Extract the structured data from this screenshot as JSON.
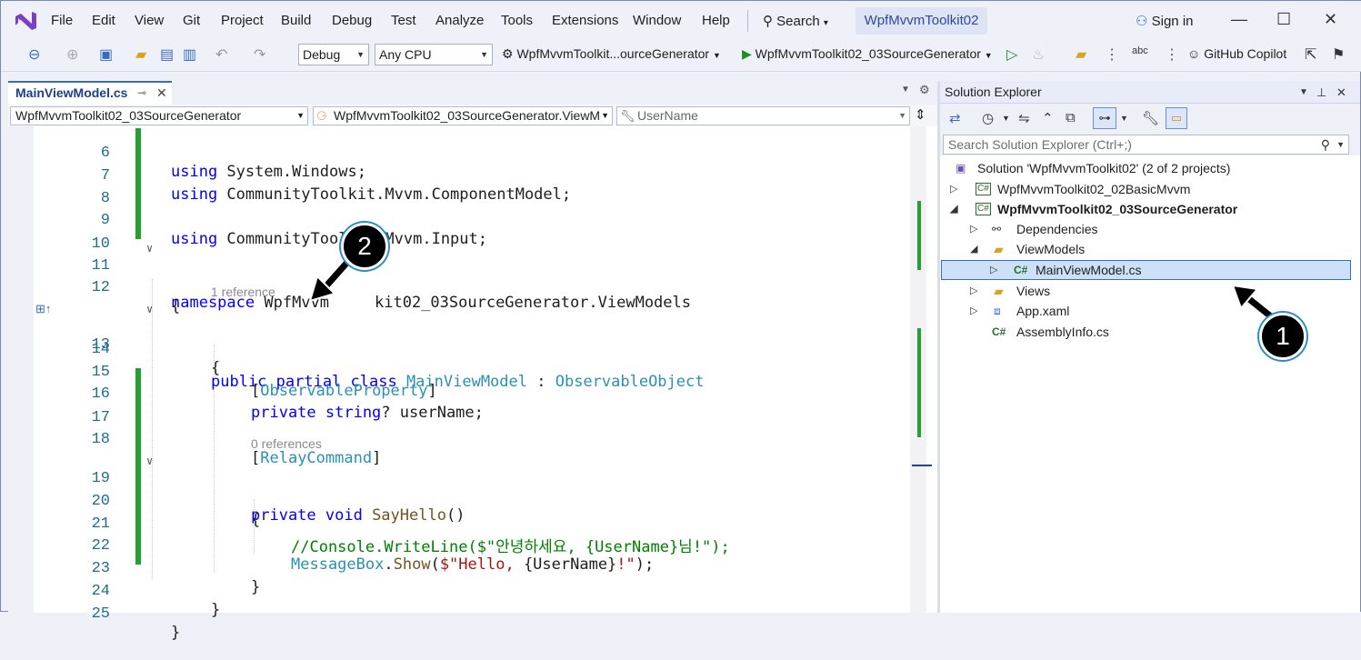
{
  "menu": [
    "File",
    "Edit",
    "View",
    "Git",
    "Project",
    "Build",
    "Debug",
    "Test",
    "Analyze",
    "Tools",
    "Extensions",
    "Window",
    "Help"
  ],
  "search_label": "Search",
  "solution_title": "WpfMvvmToolkit02",
  "sign_in": "Sign in",
  "toolbar": {
    "config": "Debug",
    "platform": "Any CPU",
    "startup_combo": "WpfMvvmToolkit...ourceGenerator",
    "run_target": "WpfMvvmToolkit02_03SourceGenerator",
    "copilot": "GitHub Copilot"
  },
  "editor": {
    "tab": "MainViewModel.cs",
    "nav_project": "WpfMvvmToolkit02_03SourceGenerator",
    "nav_type": "WpfMvvmToolkit02_03SourceGenerator.ViewM",
    "nav_member": "UserName",
    "ref_hint_1": "1 reference",
    "ref_hint_2": "0 references",
    "line_numbers": [
      "6",
      "7",
      "8",
      "9",
      "10",
      "11",
      "12",
      "13",
      "14",
      "15",
      "16",
      "17",
      "18",
      "19",
      "20",
      "21",
      "22",
      "23",
      "24",
      "25"
    ],
    "code": {
      "l6_kw": "using",
      "l6_rest": " System.Windows;",
      "l7_kw": "using",
      "l7_rest": " CommunityToolkit.Mvvm.ComponentModel;",
      "l9_kw": "using",
      "l9_rest": " CommunityToolkit.Mvvm.Input;",
      "l11_kw": "namespace",
      "l11_a": " WpfMvvm",
      "l11_b": "kit02_03SourceGenerator.ViewModels",
      "l12": "{",
      "l13_kw": "public partial class",
      "l13_type": " MainViewModel",
      "l13_colon": " : ",
      "l13_base": "ObservableObject",
      "l14": "{",
      "l15_open": "[",
      "l15_attr": "ObservableProperty",
      "l15_close": "]",
      "l16_kw": "private string",
      "l16_rest": "? userName;",
      "l18_open": "[",
      "l18_attr": "RelayCommand",
      "l18_close": "]",
      "l19_kw": "private void",
      "l19_method": " SayHello",
      "l19_rest": "()",
      "l20": "{",
      "l21_comment": "//Console.WriteLine($\"안녕하세요, {UserName}님!\");",
      "l22_type": "MessageBox",
      "l22_dot": ".",
      "l22_method": "Show",
      "l22_p": "(",
      "l22_s1": "$\"Hello, ",
      "l22_interp": "{UserName}",
      "l22_s2": "!\"",
      "l22_end": ");",
      "l23": "}",
      "l24": "}",
      "l25": "}"
    }
  },
  "solution_explorer": {
    "title": "Solution Explorer",
    "search_placeholder": "Search Solution Explorer (Ctrl+;)",
    "nodes": [
      "Solution 'WpfMvvmToolkit02' (2 of 2 projects)",
      "WpfMvvmToolkit02_02BasicMvvm",
      "WpfMvvmToolkit02_03SourceGenerator",
      "Dependencies",
      "ViewModels",
      "MainViewModel.cs",
      "Views",
      "App.xaml",
      "AssemblyInfo.cs"
    ]
  },
  "callouts": [
    "1",
    "2"
  ],
  "colors": {
    "accent": "#3a6bc4",
    "change_bar": "#22a131",
    "keyword": "#0000ff",
    "type": "#2b91af"
  }
}
